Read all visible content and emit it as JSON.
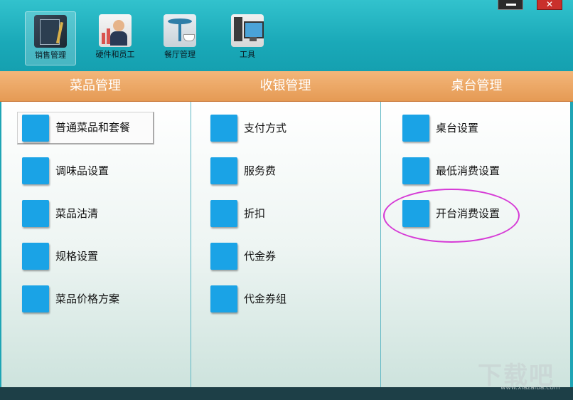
{
  "toolbar": {
    "buttons": [
      {
        "label": "销售管理",
        "icon": "notebook-icon",
        "active": true
      },
      {
        "label": "硬件和员工",
        "icon": "staff-chart-icon",
        "active": false
      },
      {
        "label": "餐厅管理",
        "icon": "dining-table-icon",
        "active": false
      },
      {
        "label": "工具",
        "icon": "computer-icon",
        "active": false
      }
    ],
    "close_label": "✕"
  },
  "columns": [
    {
      "header": "菜品管理",
      "items": [
        "普通菜品和套餐",
        "调味品设置",
        "菜品沽清",
        "规格设置",
        "菜品价格方案"
      ]
    },
    {
      "header": "收银管理",
      "items": [
        "支付方式",
        "服务费",
        "折扣",
        "代金券",
        "代金券组"
      ]
    },
    {
      "header": "桌台管理",
      "items": [
        "桌台设置",
        "最低消费设置",
        "开台消费设置"
      ]
    }
  ],
  "watermark": {
    "big": "下载吧",
    "small": "www.xiazaiba.com"
  },
  "colors": {
    "accent": "#1aa3e6",
    "header": "#e59a54",
    "toolbar": "#1aa9b8",
    "highlight_ellipse": "#d63bd6"
  }
}
